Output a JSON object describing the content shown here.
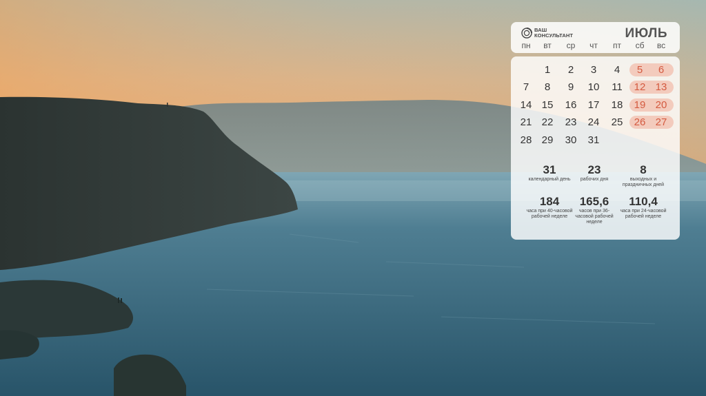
{
  "calendar": {
    "brand": {
      "line1": "ваш",
      "line2": "консультант"
    },
    "month": "ИЮЛЬ",
    "weekdays": [
      "пн",
      "вт",
      "ср",
      "чт",
      "пт",
      "сб",
      "вс"
    ],
    "weeks": [
      [
        "",
        "1",
        "2",
        "3",
        "4",
        "5",
        "6"
      ],
      [
        "7",
        "8",
        "9",
        "10",
        "11",
        "12",
        "13"
      ],
      [
        "14",
        "15",
        "16",
        "17",
        "18",
        "19",
        "20"
      ],
      [
        "21",
        "22",
        "23",
        "24",
        "25",
        "26",
        "27"
      ],
      [
        "28",
        "29",
        "30",
        "31",
        "",
        "",
        ""
      ]
    ],
    "stats_row1": [
      {
        "value": "31",
        "label": "календарный день"
      },
      {
        "value": "23",
        "label": "рабочих дня"
      },
      {
        "value": "8",
        "label": "выходных и праздничных дней"
      }
    ],
    "stats_row2": [
      {
        "value": "184",
        "label": "часа при 40-часовой рабочей неделе"
      },
      {
        "value": "165,6",
        "label": "часов при 36-часовой рабочей неделе"
      },
      {
        "value": "110,4",
        "label": "часа при 24-часовой рабочей неделе"
      }
    ],
    "colors": {
      "weekend_pill": "#f3cbbd",
      "weekend_text": "#d45a40"
    }
  }
}
